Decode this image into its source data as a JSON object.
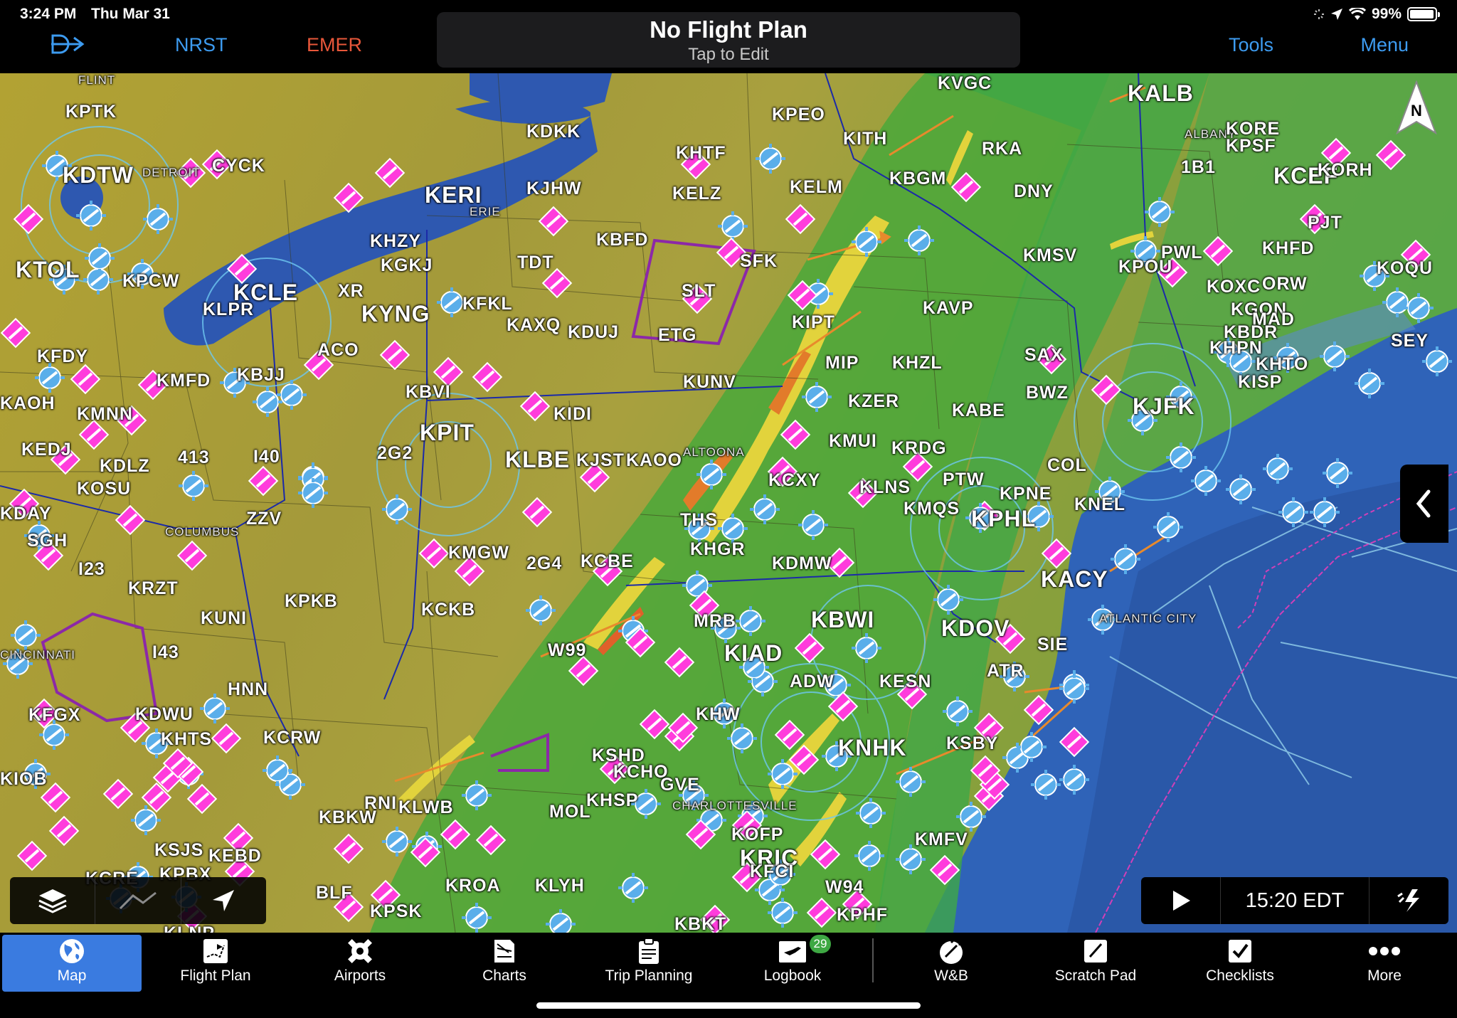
{
  "status_bar": {
    "time": "3:24 PM",
    "date": "Thu Mar 31",
    "battery": "99%"
  },
  "top_bar": {
    "direct_to_icon": "direct-to-icon",
    "nrst_label": "NRST",
    "emer_label": "EMER",
    "flight_plan_title": "No Flight Plan",
    "flight_plan_subtitle": "Tap to Edit",
    "tools_label": "Tools",
    "menu_label": "Menu"
  },
  "map": {
    "compass_letter": "N",
    "animation_time": "15:20 EDT",
    "airports_large": [
      "KDTW",
      "KTOL",
      "KCLE",
      "KERI",
      "KYNG",
      "KPIT",
      "KLBE",
      "KALB",
      "KCEF",
      "KJFK",
      "KPHL",
      "KACY",
      "KDOV",
      "KBWI",
      "KIAD",
      "KNHK",
      "KRIC"
    ],
    "labels": [
      {
        "t": "KPTK"
      },
      {
        "t": "CYCK"
      },
      {
        "t": "KPCW"
      },
      {
        "t": "KLPR"
      },
      {
        "t": "XR"
      },
      {
        "t": "KHZY"
      },
      {
        "t": "KGKJ"
      },
      {
        "t": "KFKL"
      },
      {
        "t": "TDT"
      },
      {
        "t": "KDKK"
      },
      {
        "t": "KJHW"
      },
      {
        "t": "KBFD"
      },
      {
        "t": "KELZ"
      },
      {
        "t": "KHTF"
      },
      {
        "t": "KPEO"
      },
      {
        "t": "KITH"
      },
      {
        "t": "KELM"
      },
      {
        "t": "KBGM"
      },
      {
        "t": "KVGC"
      },
      {
        "t": "RKA"
      },
      {
        "t": "DNY"
      },
      {
        "t": "KMSV"
      },
      {
        "t": "SFK"
      },
      {
        "t": "SLT"
      },
      {
        "t": "ETG"
      },
      {
        "t": "KAXQ"
      },
      {
        "t": "KDUJ"
      },
      {
        "t": "KFDY"
      },
      {
        "t": "KMFD"
      },
      {
        "t": "KBJJ"
      },
      {
        "t": "ACO"
      },
      {
        "t": "KBVI"
      },
      {
        "t": "KIDI"
      },
      {
        "t": "KUNV"
      },
      {
        "t": "KIPT"
      },
      {
        "t": "MIP"
      },
      {
        "t": "KAVP"
      },
      {
        "t": "KHZL"
      },
      {
        "t": "KZER"
      },
      {
        "t": "KABE"
      },
      {
        "t": "KMUI"
      },
      {
        "t": "KRDG"
      },
      {
        "t": "BWZ"
      },
      {
        "t": "SAX"
      },
      {
        "t": "KPOU"
      },
      {
        "t": "PWL"
      },
      {
        "t": "KHFD"
      },
      {
        "t": "KOXC"
      },
      {
        "t": "ORW"
      },
      {
        "t": "KGON"
      },
      {
        "t": "MAD"
      },
      {
        "t": "KBDR"
      },
      {
        "t": "KHPN"
      },
      {
        "t": "KISP"
      },
      {
        "t": "KHTO"
      },
      {
        "t": "SEY"
      },
      {
        "t": "KORE"
      },
      {
        "t": "KPSF"
      },
      {
        "t": "1B1"
      },
      {
        "t": "KORH"
      },
      {
        "t": "PJT"
      },
      {
        "t": "KOQU"
      },
      {
        "t": "KAOH"
      },
      {
        "t": "KMNN"
      },
      {
        "t": "KEDJ"
      },
      {
        "t": "KDLZ"
      },
      {
        "t": "413"
      },
      {
        "t": "I40"
      },
      {
        "t": "2G2"
      },
      {
        "t": "KJST"
      },
      {
        "t": "KAOO"
      },
      {
        "t": "KOSU"
      },
      {
        "t": "ZZV"
      },
      {
        "t": "SGH"
      },
      {
        "t": "I23"
      },
      {
        "t": "KRZT"
      },
      {
        "t": "KUNI"
      },
      {
        "t": "KPKB"
      },
      {
        "t": "KCKB"
      },
      {
        "t": "KMGW"
      },
      {
        "t": "2G4"
      },
      {
        "t": "KCBE"
      },
      {
        "t": "THS"
      },
      {
        "t": "KHGR"
      },
      {
        "t": "KDMW"
      },
      {
        "t": "KCXY"
      },
      {
        "t": "KLNS"
      },
      {
        "t": "PTW"
      },
      {
        "t": "KMQS"
      },
      {
        "t": "KPNE"
      },
      {
        "t": "KNEL"
      },
      {
        "t": "COL"
      },
      {
        "t": "I43"
      },
      {
        "t": "HNN"
      },
      {
        "t": "KDWU"
      },
      {
        "t": "KFGX"
      },
      {
        "t": "KHTS"
      },
      {
        "t": "KCRW"
      },
      {
        "t": "W99"
      },
      {
        "t": "MRB"
      },
      {
        "t": "KESN"
      },
      {
        "t": "ADW"
      },
      {
        "t": "SIE"
      },
      {
        "t": "ATR"
      },
      {
        "t": "KSBY"
      },
      {
        "t": "KIOB"
      },
      {
        "t": "KSHD"
      },
      {
        "t": "KCHO"
      },
      {
        "t": "GVE"
      },
      {
        "t": "KHSP"
      },
      {
        "t": "MOL"
      },
      {
        "t": "KLWB"
      },
      {
        "t": "RNI"
      },
      {
        "t": "KBKW"
      },
      {
        "t": "KSJS"
      },
      {
        "t": "KEBD"
      },
      {
        "t": "KPBX"
      },
      {
        "t": "KOFP"
      },
      {
        "t": "KFCI"
      },
      {
        "t": "W94"
      },
      {
        "t": "KMFV"
      },
      {
        "t": "KPHF"
      },
      {
        "t": "KBKT"
      },
      {
        "t": "BLF"
      },
      {
        "t": "KROA"
      },
      {
        "t": "KLYH"
      },
      {
        "t": "KPSK"
      },
      {
        "t": "KLNP"
      },
      {
        "t": "KCRE"
      },
      {
        "t": "KHW"
      },
      {
        "t": "KDAY"
      }
    ],
    "city_labels": [
      "FLINT",
      "ERIE",
      "ALTOONA",
      "ATLANTIC CITY",
      "CHARLOTTESVILLE",
      "ALBANY",
      "COLUMBUS",
      "CINCINNATI",
      "DETROIT"
    ]
  },
  "tabs": [
    {
      "label": "Map",
      "icon": "globe-icon",
      "active": true
    },
    {
      "label": "Flight Plan",
      "icon": "flight-plan-icon"
    },
    {
      "label": "Airports",
      "icon": "airport-icon"
    },
    {
      "label": "Charts",
      "icon": "charts-icon"
    },
    {
      "label": "Trip Planning",
      "icon": "trip-planning-icon"
    },
    {
      "label": "Logbook",
      "icon": "logbook-icon",
      "badge": "29"
    },
    {
      "label": "W&B",
      "icon": "weight-balance-icon"
    },
    {
      "label": "Scratch Pad",
      "icon": "scratch-pad-icon"
    },
    {
      "label": "Checklists",
      "icon": "checklist-icon"
    },
    {
      "label": "More",
      "icon": "more-icon"
    }
  ],
  "colors": {
    "accent_blue": "#3d9bf0",
    "emergency": "#e8573a",
    "vfr_magenta": "#ff3cdc",
    "towered_blue": "#5aaeea",
    "active_tab": "#3a7be0"
  }
}
